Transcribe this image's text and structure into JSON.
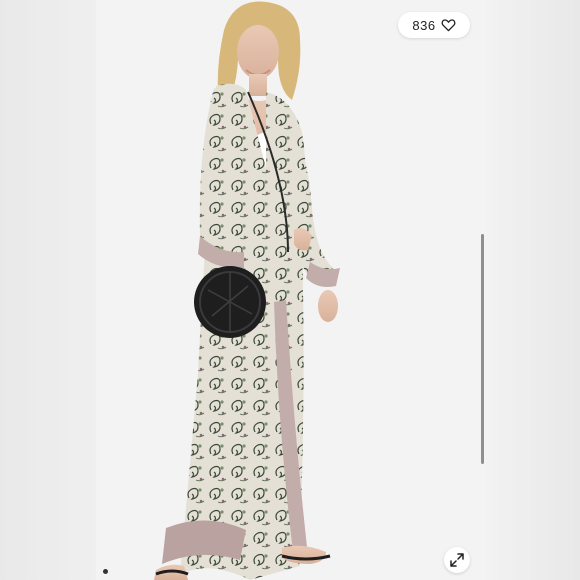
{
  "likes": {
    "count": "836",
    "icon": "heart-outline-icon"
  },
  "gallery": {
    "image_count_dots": 1,
    "active_index": 0
  },
  "controls": {
    "expand_icon": "expand-arrows-icon"
  },
  "colors": {
    "pill_background": "#ffffff",
    "page_background": "#ececec",
    "scrollbar": "#8f8f8f"
  }
}
